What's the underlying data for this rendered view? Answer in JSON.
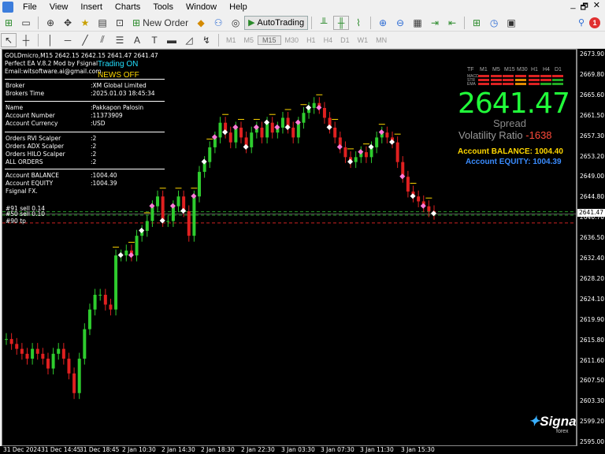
{
  "menu": [
    "File",
    "View",
    "Insert",
    "Charts",
    "Tools",
    "Window",
    "Help"
  ],
  "window_controls": [
    "_",
    "🗗",
    "✕"
  ],
  "toolbar": {
    "new_order": "New Order",
    "autotrading": "AutoTrading"
  },
  "timeframes": [
    "M1",
    "M5",
    "M15",
    "M30",
    "H1",
    "H4",
    "D1",
    "W1",
    "MN"
  ],
  "active_timeframe": "M15",
  "notification_count": "1",
  "chart": {
    "header": "GOLDmicro,M15  2642.15 2642.15 2641.47 2641.47",
    "ea_line": "Perfect EA V.8.2 Mod by Fsignal",
    "email_line": "Email:witsoftware.ai@gmail.com",
    "trading_status": "Trading ON",
    "news_status": "NEWS OFF",
    "info_rows": [
      {
        "label": "Broker",
        "value": ":XM Global Limited"
      },
      {
        "label": "Brokers Time",
        "value": ":2025.01.03 18:45:34"
      },
      {
        "label": "Name",
        "value": ":Pakkapon Palosin"
      },
      {
        "label": "Account Number",
        "value": ":11373909"
      },
      {
        "label": "Account Currency",
        "value": ":USD"
      },
      {
        "label": "Orders RVI Scalper",
        "value": ":2"
      },
      {
        "label": "Orders ADX Scalper",
        "value": ":2"
      },
      {
        "label": "Orders HILO Scalper",
        "value": ":2"
      },
      {
        "label": "ALL ORDERS",
        "value": ":2"
      },
      {
        "label": "Account BALANCE",
        "value": ":1004.40"
      },
      {
        "label": "Account EQUITY",
        "value": ":1004.39"
      }
    ],
    "footer_line": "Fsignal FX.",
    "order_labels": [
      "#91 sell 0.14",
      "#50 sell 0.10",
      "#90 tp"
    ],
    "tf_headers": [
      "TF",
      "M1",
      "M5",
      "M15",
      "M30",
      "H1",
      "H4",
      "D1"
    ],
    "tf_rows": [
      "MACD",
      "STR",
      "EMA"
    ],
    "big_price": "2641.47",
    "spread_label": "Spread",
    "volatility_label": "Volatility Ratio",
    "volatility_value": "-1638",
    "balance_label": "Account BALANCE:",
    "balance_value": "1004.40",
    "equity_label": "Account EQUITY:",
    "equity_value": "1004.39",
    "logo_text": "Signal",
    "logo_sub": "forex"
  },
  "price_axis": [
    "2673.90",
    "2669.80",
    "2665.60",
    "2661.50",
    "2657.30",
    "2653.20",
    "2649.00",
    "2644.80",
    "2640.70",
    "2636.50",
    "2632.40",
    "2628.20",
    "2624.10",
    "2619.90",
    "2615.80",
    "2611.60",
    "2607.50",
    "2603.30",
    "2599.20",
    "2595.00"
  ],
  "current_price": "2641.47",
  "time_axis": [
    "31 Dec 2024",
    "31 Dec 14:45",
    "31 Dec 18:45",
    "2 Jan 10:30",
    "2 Jan 14:30",
    "2 Jan 18:30",
    "2 Jan 22:30",
    "3 Jan 03:30",
    "3 Jan 07:30",
    "3 Jan 11:30",
    "3 Jan 15:30"
  ],
  "chart_data": {
    "type": "candlestick",
    "symbol": "GOLDmicro",
    "timeframe": "M15",
    "ylim": [
      2595.0,
      2673.9
    ],
    "close_path": [
      2616,
      2615,
      2614,
      2613,
      2612,
      2614,
      2613,
      2612,
      2610,
      2613,
      2614,
      2612,
      2609,
      2605,
      2612,
      2618,
      2622,
      2625,
      2625,
      2623,
      2622,
      2633,
      2633,
      2634,
      2633,
      2637,
      2638,
      2640,
      2643,
      2645,
      2640,
      2640,
      2643,
      2645,
      2642,
      2637,
      2645,
      2650,
      2652,
      2655,
      2657,
      2660,
      2658,
      2656,
      2659,
      2657,
      2655,
      2658,
      2659,
      2657,
      2660,
      2658,
      2659,
      2661,
      2659,
      2657,
      2660,
      2662,
      2663,
      2664,
      2663,
      2661,
      2659,
      2657,
      2655,
      2653,
      2652,
      2653,
      2654,
      2653,
      2655,
      2657,
      2658,
      2657,
      2656,
      2652,
      2649,
      2646,
      2645,
      2644,
      2643,
      2642,
      2641.47
    ]
  }
}
